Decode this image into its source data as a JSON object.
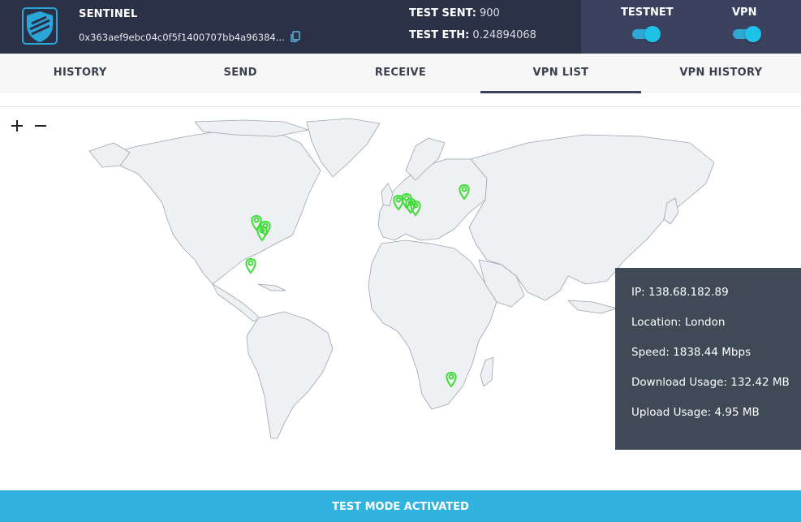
{
  "header": {
    "brand": "SENTINEL",
    "address": "0x363aef9ebc04c0f5f1400707bb4a96384...",
    "balances": {
      "sent_label": "TEST SENT:",
      "sent_value": "900",
      "eth_label": "TEST ETH:",
      "eth_value": "0.24894068"
    },
    "toggles": {
      "testnet_label": "TESTNET",
      "testnet_on": true,
      "vpn_label": "VPN",
      "vpn_on": true
    },
    "icons": [
      "shield-logo",
      "copy-icon"
    ]
  },
  "tabs": [
    {
      "label": "HISTORY",
      "active": false
    },
    {
      "label": "SEND",
      "active": false
    },
    {
      "label": "RECEIVE",
      "active": false
    },
    {
      "label": "VPN LIST",
      "active": true
    },
    {
      "label": "VPN HISTORY",
      "active": false
    }
  ],
  "map": {
    "zoom_in_icon": "plus-icon",
    "zoom_out_icon": "minus-icon",
    "marker_color": "#3fdc38",
    "land_color": "#eef0f3",
    "border_color": "#9aa4b2"
  },
  "tooltip": {
    "ip": "IP: 138.68.182.89",
    "location": "Location: London",
    "speed": "Speed: 1838.44 Mbps",
    "download": "Download Usage: 132.42 MB",
    "upload": "Upload Usage: 4.95 MB"
  },
  "footer": {
    "status": "TEST MODE ACTIVATED"
  },
  "colors": {
    "header_bg": "#2b3147",
    "toggle_panel_bg": "#3b4260",
    "toggle_color": "#1fc1e8",
    "footer_bg": "#32b3df",
    "tooltip_bg": "#3f4a56"
  }
}
